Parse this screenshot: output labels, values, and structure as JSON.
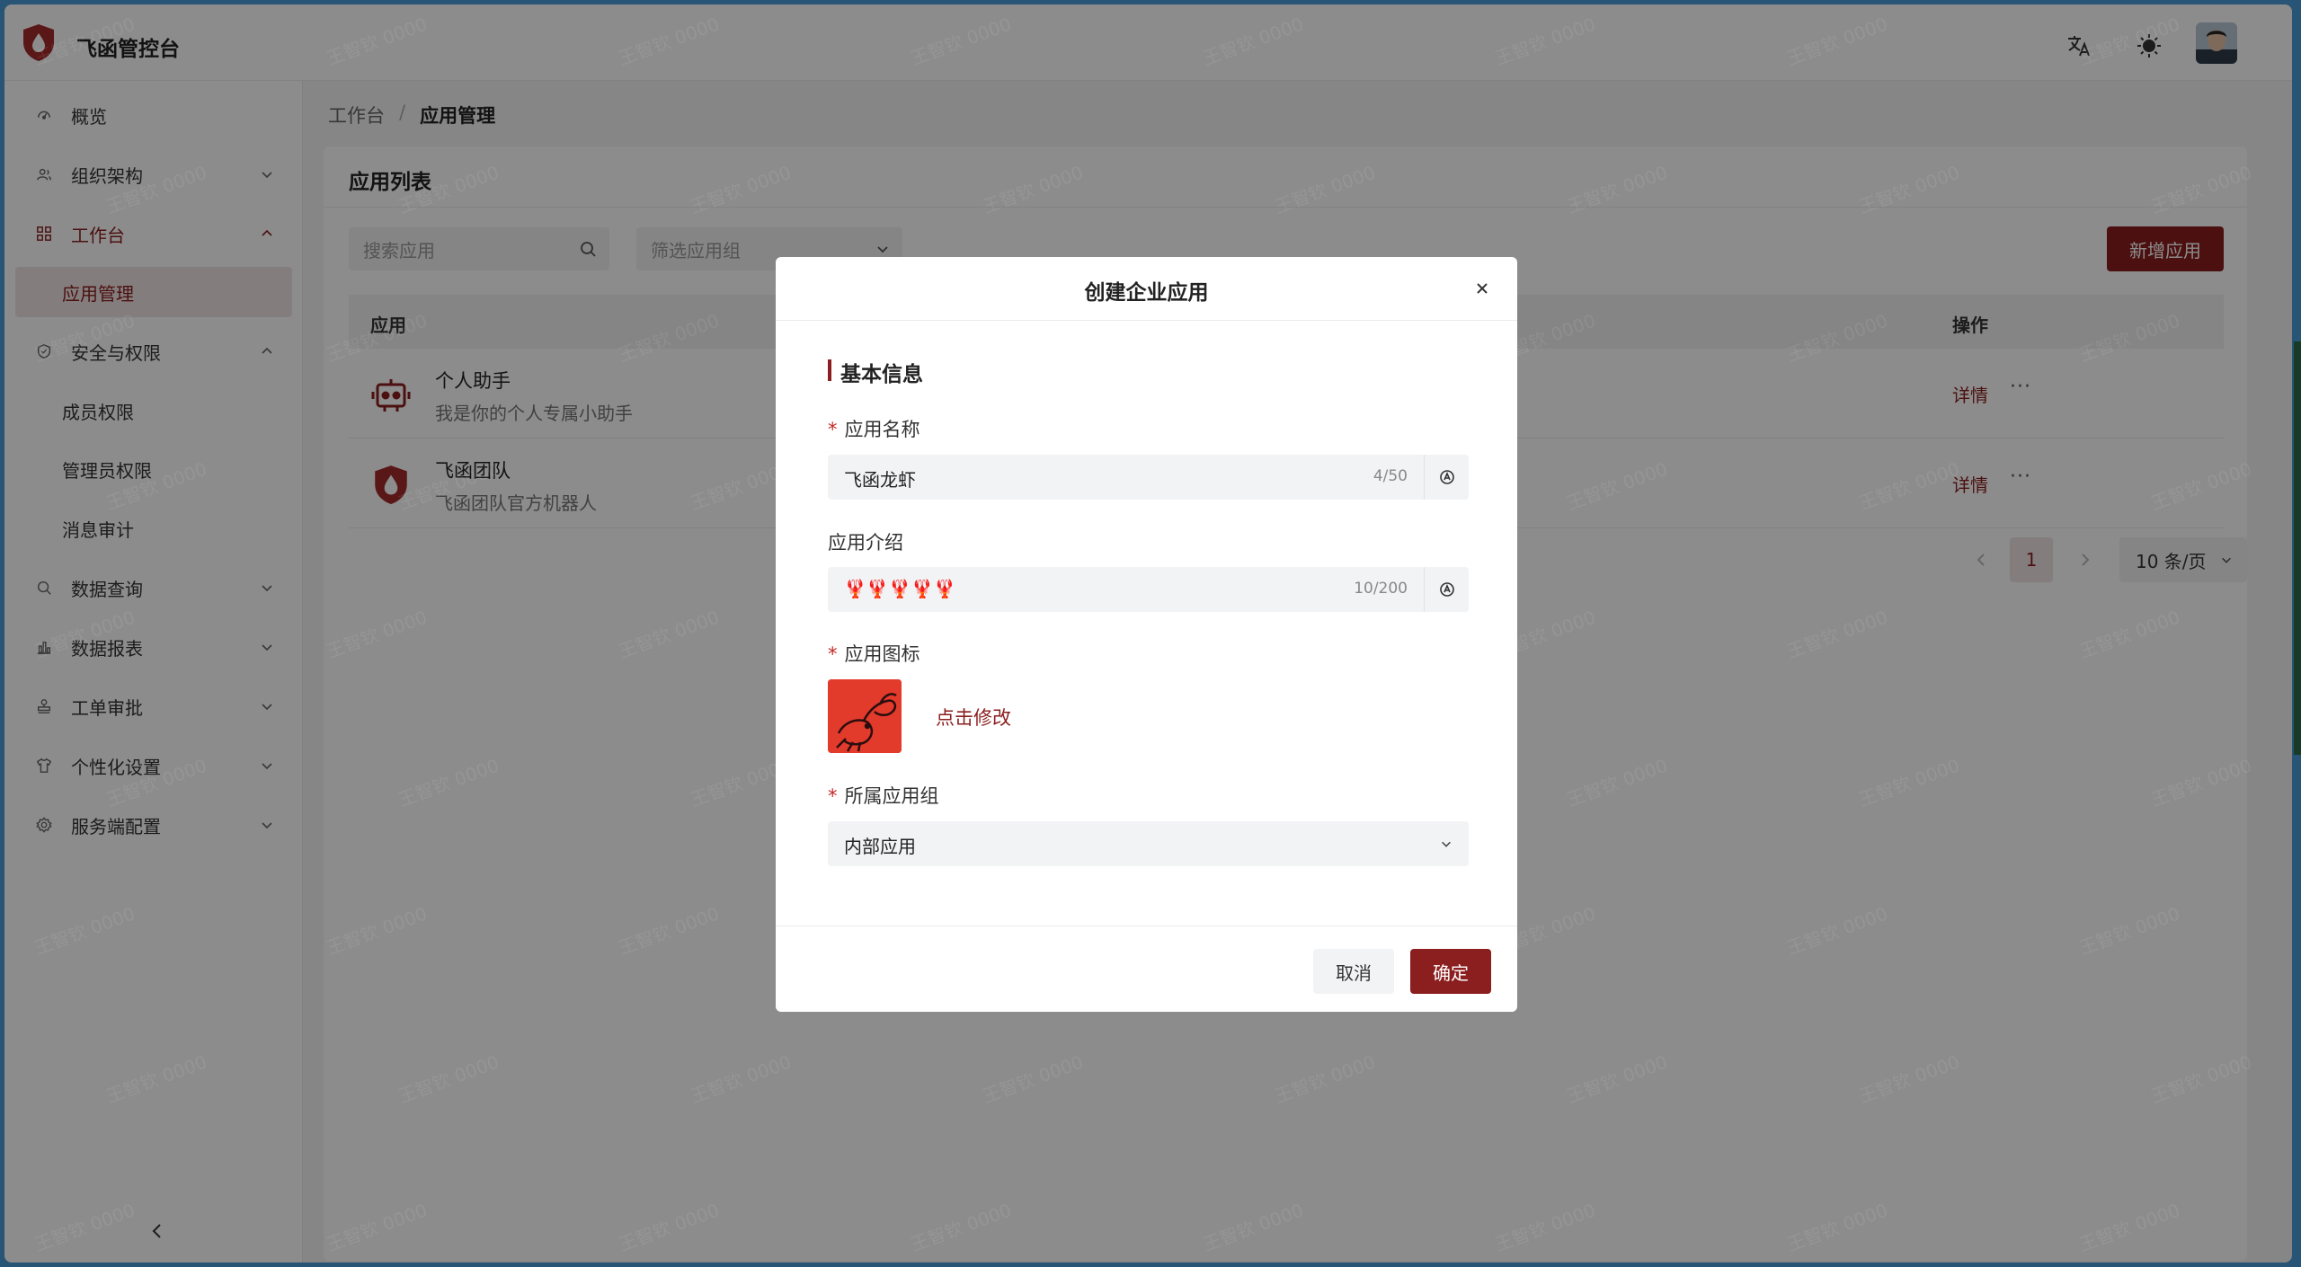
{
  "header": {
    "app_title": "飞函管控台",
    "icons": [
      "logo-icon",
      "translate-icon",
      "theme-toggle-icon",
      "avatar"
    ]
  },
  "sidebar": {
    "items": [
      {
        "label": "概览",
        "icon": "dashboard-icon"
      },
      {
        "label": "组织架构",
        "icon": "org-icon"
      },
      {
        "label": "工作台",
        "icon": "grid-icon"
      },
      {
        "label": "应用管理"
      },
      {
        "label": "安全与权限",
        "icon": "shield-icon"
      },
      {
        "label": "成员权限"
      },
      {
        "label": "管理员权限"
      },
      {
        "label": "消息审计"
      },
      {
        "label": "数据查询",
        "icon": "search-icon"
      },
      {
        "label": "数据报表",
        "icon": "bar-chart-icon"
      },
      {
        "label": "工单审批",
        "icon": "stamp-icon"
      },
      {
        "label": "个性化设置",
        "icon": "shirt-icon"
      },
      {
        "label": "服务端配置",
        "icon": "gear-icon"
      }
    ]
  },
  "breadcrumb": {
    "root": "工作台",
    "separator": "/",
    "current": "应用管理"
  },
  "main": {
    "card_title": "应用列表",
    "search_placeholder": "搜索应用",
    "filter_placeholder": "筛选应用组",
    "add_button": "新增应用",
    "columns": {
      "app": "应用",
      "actions": "操作"
    },
    "rows": [
      {
        "name": "个人助手",
        "desc": "我是你的个人专属小助手",
        "detail": "详情",
        "more": "···"
      },
      {
        "name": "飞函团队",
        "desc": "飞函团队官方机器人",
        "detail": "详情",
        "more": "···"
      }
    ],
    "pagination": {
      "page": "1",
      "page_size": "10 条/页"
    }
  },
  "watermark": "王智钦 0000",
  "modal": {
    "title": "创建企业应用",
    "section_title": "基本信息",
    "name_label": "应用名称",
    "name_value": "飞函龙虾",
    "name_count": "4/50",
    "intro_label": "应用介绍",
    "intro_value": "🦞🦞🦞🦞🦞",
    "intro_count": "10/200",
    "icon_label": "应用图标",
    "change_icon": "点击修改",
    "group_label": "所属应用组",
    "group_value": "内部应用",
    "required_mark": "*",
    "cancel": "取消",
    "ok": "确定"
  },
  "colors": {
    "brand": "#8b1e1e",
    "brand_light": "#f1e3e3",
    "overlay": "rgba(0,0,0,0.45)"
  }
}
